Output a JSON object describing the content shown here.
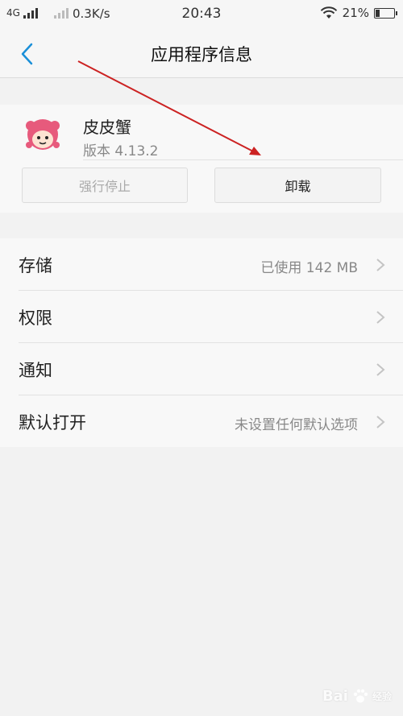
{
  "status_bar": {
    "network": "4G",
    "speed": "0.3K/s",
    "time": "20:43",
    "battery": "21%",
    "battery_level": 0.21
  },
  "header": {
    "title": "应用程序信息"
  },
  "app": {
    "name": "皮皮蟹",
    "version": "版本 4.13.2",
    "force_stop_label": "强行停止",
    "uninstall_label": "卸载"
  },
  "settings": [
    {
      "label": "存储",
      "value": "已使用 142 MB"
    },
    {
      "label": "权限",
      "value": ""
    },
    {
      "label": "通知",
      "value": ""
    },
    {
      "label": "默认打开",
      "value": "未设置任何默认选项"
    }
  ],
  "watermark": {
    "text": "Bai",
    "sub": "经验"
  },
  "colors": {
    "accent": "#1a8fd8",
    "annotation_arrow": "#cc2222"
  }
}
